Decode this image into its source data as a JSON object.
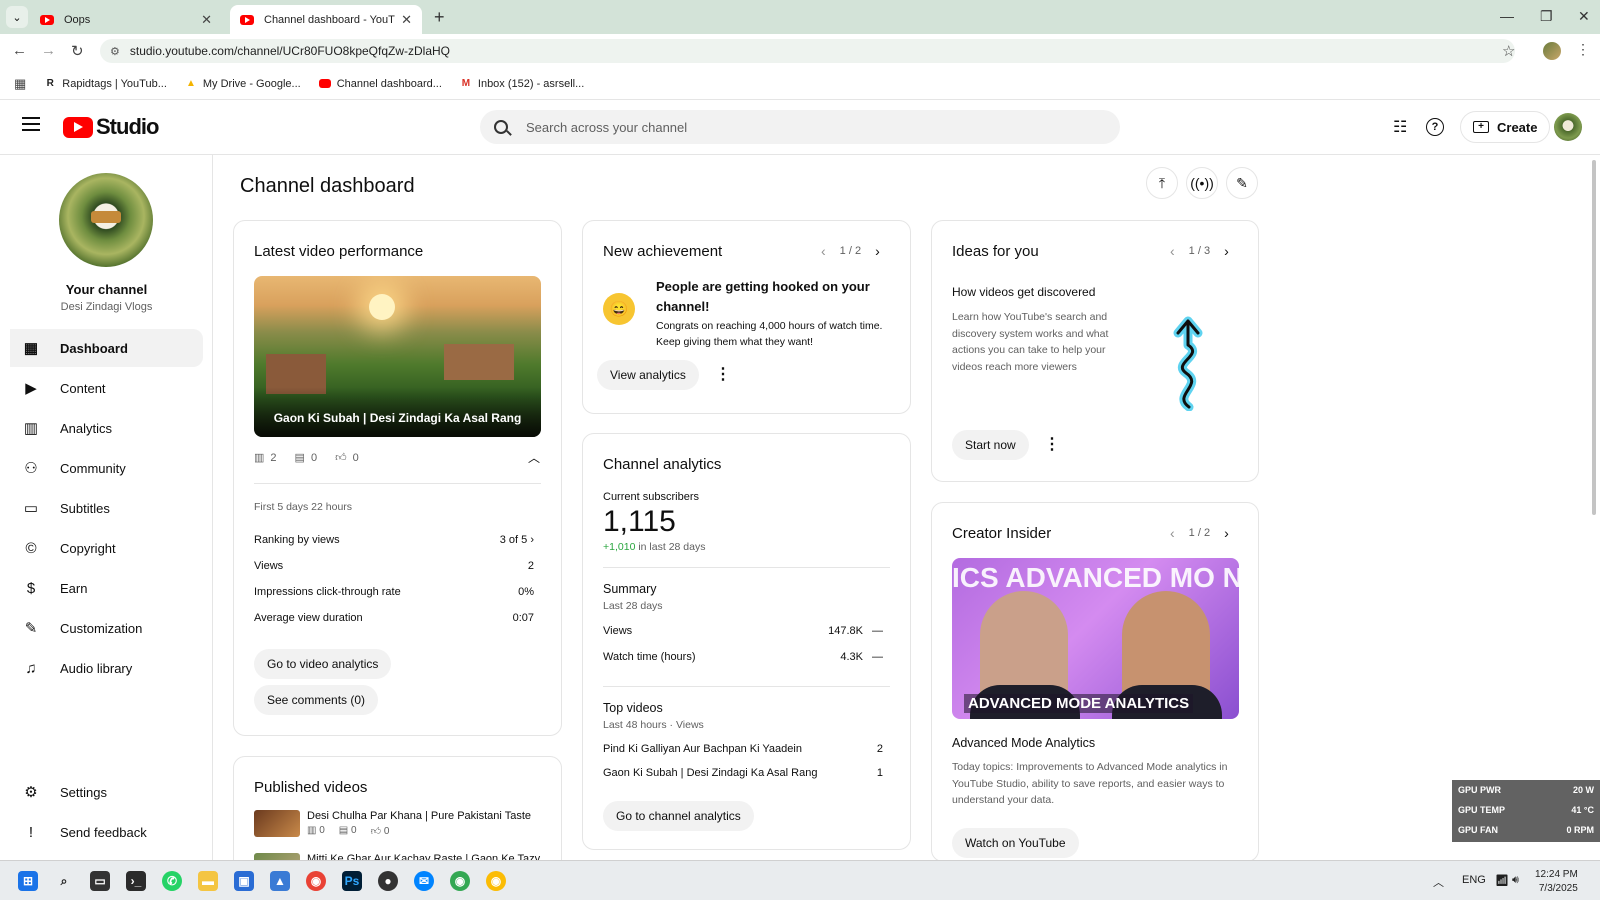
{
  "browser": {
    "tabs": [
      {
        "title": "Oops",
        "active": false
      },
      {
        "title": "Channel dashboard - YouTube S",
        "active": true
      }
    ],
    "url": "studio.youtube.com/channel/UCr80FUO8kpeQfqZw-zDlaHQ",
    "bookmarks": [
      {
        "label": "Rapidtags | YouTub...",
        "icon": "R"
      },
      {
        "label": "My Drive - Google...",
        "icon": "drive"
      },
      {
        "label": "Channel dashboard...",
        "icon": "youtube"
      },
      {
        "label": "Inbox (152) - asrsell...",
        "icon": "gmail"
      }
    ]
  },
  "header": {
    "logo_text": "Studio",
    "search_placeholder": "Search across your channel",
    "create_label": "Create"
  },
  "sidebar": {
    "your_channel": "Your channel",
    "channel_name": "Desi Zindagi Vlogs",
    "items": [
      {
        "label": "Dashboard",
        "icon": "dashboard-icon",
        "active": true
      },
      {
        "label": "Content",
        "icon": "content-icon"
      },
      {
        "label": "Analytics",
        "icon": "analytics-icon"
      },
      {
        "label": "Community",
        "icon": "community-icon"
      },
      {
        "label": "Subtitles",
        "icon": "subtitles-icon"
      },
      {
        "label": "Copyright",
        "icon": "copyright-icon"
      },
      {
        "label": "Earn",
        "icon": "earn-icon"
      },
      {
        "label": "Customization",
        "icon": "customization-icon"
      },
      {
        "label": "Audio library",
        "icon": "audio-library-icon"
      }
    ],
    "settings": "Settings",
    "feedback": "Send feedback"
  },
  "main": {
    "title": "Channel dashboard",
    "latest": {
      "title": "Latest video performance",
      "video_title": "Gaon Ki Subah | Desi Zindagi Ka Asal Rang",
      "views": "2",
      "comments": "0",
      "likes": "0",
      "period": "First 5 days 22 hours",
      "rows": [
        {
          "label": "Ranking by views",
          "value": "3 of 5"
        },
        {
          "label": "Views",
          "value": "2"
        },
        {
          "label": "Impressions click-through rate",
          "value": "0%"
        },
        {
          "label": "Average view duration",
          "value": "0:07"
        }
      ],
      "btn_analytics": "Go to video analytics",
      "btn_comments": "See comments (0)"
    },
    "published": {
      "title": "Published videos",
      "items": [
        {
          "title": "Desi Chulha Par Khana | Pure Pakistani Taste",
          "views": "0",
          "comments": "0",
          "likes": "0"
        },
        {
          "title": "Mitti Ke Ghar Aur Kachay Raste | Gaon Ke Tazy",
          "views": "",
          "comments": "",
          "likes": ""
        }
      ]
    },
    "achievement": {
      "title": "New achievement",
      "pager": "1 / 2",
      "headline": "People are getting hooked on your channel!",
      "body": "Congrats on reaching 4,000 hours of watch time. Keep giving them what they want!",
      "button": "View analytics"
    },
    "channel_analytics": {
      "title": "Channel analytics",
      "subs_label": "Current subscribers",
      "subs": "1,115",
      "delta": "+1,010",
      "delta_suffix": "in last 28 days",
      "summary_title": "Summary",
      "summary_sub": "Last 28 days",
      "summary": [
        {
          "label": "Views",
          "value": "147.8K",
          "trend": "—"
        },
        {
          "label": "Watch time (hours)",
          "value": "4.3K",
          "trend": "—"
        }
      ],
      "top_title": "Top videos",
      "top_sub": "Last 48 hours · Views",
      "top": [
        {
          "label": "Pind Ki Galliyan Aur Bachpan Ki Yaadein",
          "value": "2"
        },
        {
          "label": "Gaon Ki Subah | Desi Zindagi Ka Asal Rang",
          "value": "1"
        }
      ],
      "button": "Go to channel analytics"
    },
    "ideas": {
      "title": "Ideas for you",
      "pager": "1 / 3",
      "headline": "How videos get discovered",
      "body": "Learn how YouTube's search and discovery system works and what actions you can take to help your videos reach more viewers",
      "button": "Start now"
    },
    "creator_insider": {
      "title": "Creator Insider",
      "pager": "1 / 2",
      "thumb_text": "ICS ADVANCED MO NCED MODE A DANALYTICS A",
      "thumb_banner": "ADVANCED MODE ANALYTICS",
      "video_title": "Advanced Mode Analytics",
      "body": "Today topics: Improvements to Advanced Mode analytics in YouTube Studio, ability to save reports, and easier ways to understand your data.",
      "button": "Watch on YouTube"
    }
  },
  "gpu": [
    {
      "label": "GPU PWR",
      "value": "20 W"
    },
    {
      "label": "GPU TEMP",
      "value": "41 °C"
    },
    {
      "label": "GPU FAN",
      "value": "0 RPM"
    }
  ],
  "taskbar": {
    "lang": "ENG",
    "time": "12:24 PM",
    "date": "7/3/2025"
  },
  "colors": {
    "youtube_red": "#ff0000",
    "positive_green": "#2ba640",
    "active_nav_bg": "#f2f2f2"
  }
}
